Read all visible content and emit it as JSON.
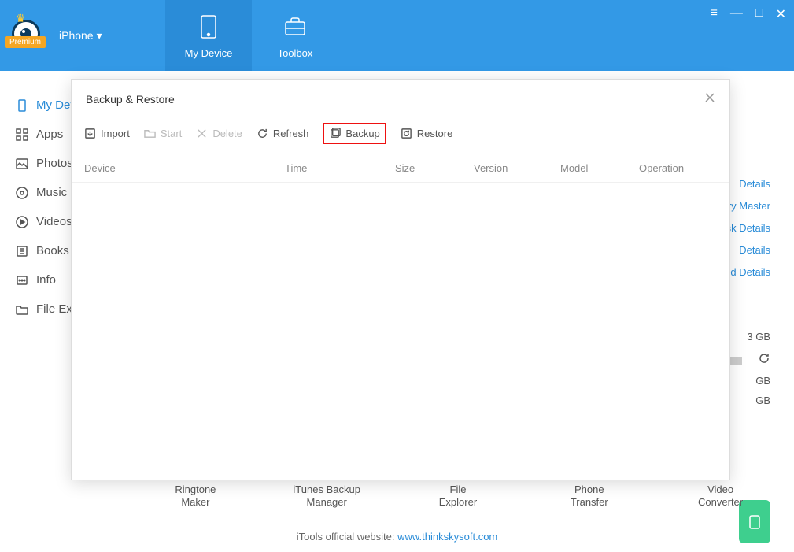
{
  "header": {
    "premium_label": "Premium",
    "device_select": "iPhone",
    "nav": {
      "my_device": "My Device",
      "toolbox": "Toolbox"
    }
  },
  "win_controls": {
    "menu": "≡",
    "min": "—",
    "max": "□",
    "close": "✕"
  },
  "sidebar": {
    "items": [
      {
        "label": "My Device"
      },
      {
        "label": "Apps"
      },
      {
        "label": "Photos"
      },
      {
        "label": "Music"
      },
      {
        "label": "Videos"
      },
      {
        "label": "Books"
      },
      {
        "label": "Info"
      },
      {
        "label": "File Explorer"
      }
    ]
  },
  "right_links": {
    "details1": "Details",
    "battery": "ery Master",
    "disk": "isk Details",
    "details2": "Details",
    "cloud": "ud Details"
  },
  "storage": {
    "total": "3 GB",
    "used": "GB",
    "free": "GB"
  },
  "bottom": [
    {
      "line1": "Ringtone",
      "line2": "Maker"
    },
    {
      "line1": "iTunes Backup",
      "line2": "Manager"
    },
    {
      "line1": "File",
      "line2": "Explorer"
    },
    {
      "line1": "Phone",
      "line2": "Transfer"
    },
    {
      "line1": "Video",
      "line2": "Converter"
    }
  ],
  "footer": {
    "prefix": "iTools official website: ",
    "link": "www.thinkskysoft.com"
  },
  "modal": {
    "title": "Backup & Restore",
    "toolbar": {
      "import": "Import",
      "start": "Start",
      "delete": "Delete",
      "refresh": "Refresh",
      "backup": "Backup",
      "restore": "Restore"
    },
    "columns": {
      "device": "Device",
      "time": "Time",
      "size": "Size",
      "version": "Version",
      "model": "Model",
      "operation": "Operation"
    }
  }
}
